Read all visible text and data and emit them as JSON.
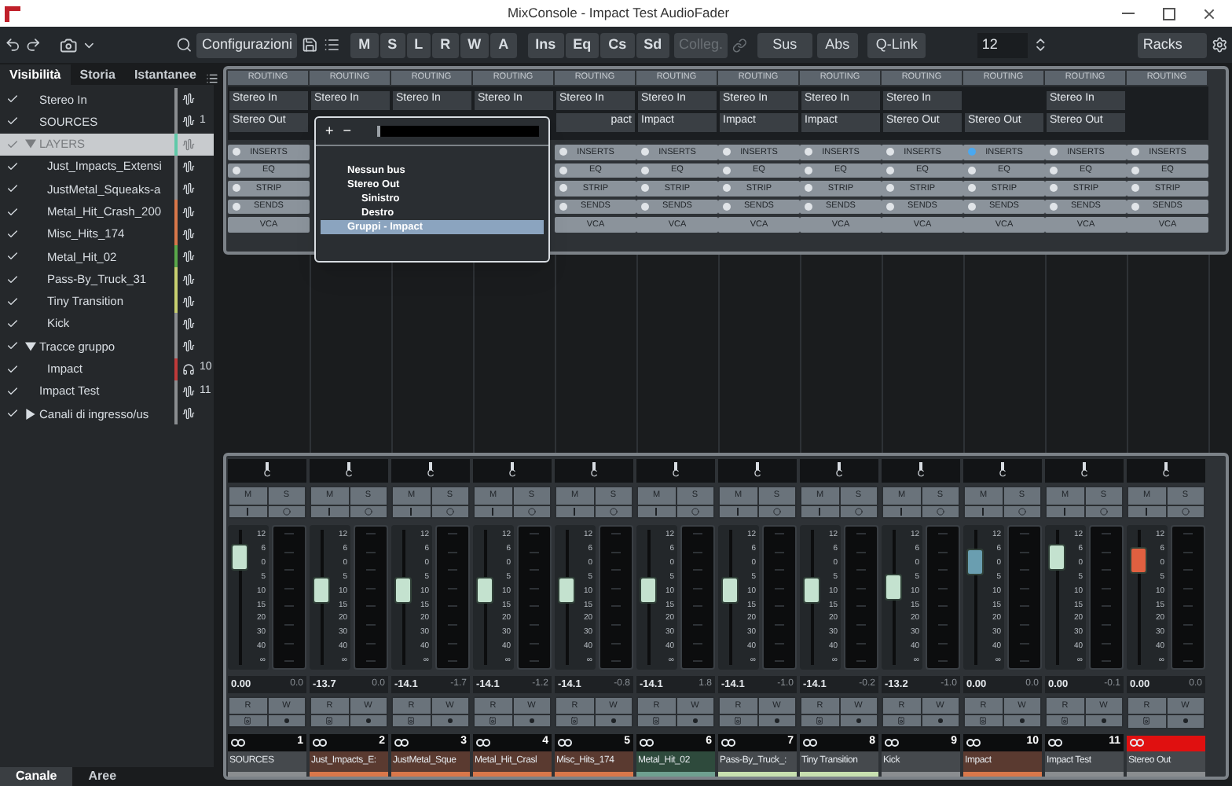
{
  "window": {
    "title": "MixConsole - Impact Test AudioFader"
  },
  "toolbar": {
    "config": "Configurazioni",
    "modes": [
      "M",
      "S",
      "L",
      "R",
      "W",
      "A"
    ],
    "views": [
      "Ins",
      "Eq",
      "Cs",
      "Sd"
    ],
    "link": "Colleg.",
    "sus": "Sus",
    "abs": "Abs",
    "qlink": "Q-Link",
    "count": "12",
    "racks": "Racks"
  },
  "left_tabs": [
    {
      "label": "Visibilità",
      "selected": true
    },
    {
      "label": "Storia",
      "selected": false
    },
    {
      "label": "Istantanee",
      "selected": false
    }
  ],
  "tree": [
    {
      "name": "Stereo In",
      "checked": true,
      "color": "#8a8d90"
    },
    {
      "name": "SOURCES",
      "checked": true,
      "color": "#8a8d90",
      "number": "1"
    },
    {
      "name": "LAYERS",
      "checked": true,
      "selected": true,
      "expanded": true,
      "color": "#5fc9a8",
      "children": [
        {
          "name": "Just_Impacts_Extensi",
          "checked": true,
          "color": "#8a8d90"
        },
        {
          "name": "JustMetal_Squeaks-a",
          "checked": true,
          "color": "#8a8d90"
        },
        {
          "name": "Metal_Hit_Crash_200",
          "checked": true,
          "color": "#d9774a"
        },
        {
          "name": "Misc_Hits_174",
          "checked": true,
          "color": "#d9774a"
        },
        {
          "name": "Metal_Hit_02",
          "checked": true,
          "color": "#5aa84a"
        },
        {
          "name": "Pass-By_Truck_31",
          "checked": true,
          "color": "#c8d070"
        },
        {
          "name": "Tiny Transition",
          "checked": true,
          "color": "#c8d070"
        },
        {
          "name": "Kick",
          "checked": true,
          "color": "#8a8d90"
        }
      ]
    },
    {
      "name": "Tracce gruppo",
      "checked": true,
      "expanded": true,
      "color": "#8a8d90",
      "children": [
        {
          "name": "Impact",
          "checked": true,
          "color": "#c03a3a",
          "number": "10",
          "kind": "group"
        }
      ]
    },
    {
      "name": "Impact Test",
      "checked": true,
      "color": "#8a8d90",
      "number": "11"
    },
    {
      "name": "Canali di ingresso/us",
      "checked": true,
      "expanded": false,
      "color": "#8a8d90"
    }
  ],
  "bottom_tabs": [
    {
      "label": "Canale",
      "selected": true
    },
    {
      "label": "Aree",
      "selected": false
    }
  ],
  "popup": {
    "plus": "+",
    "minus": "−",
    "items": [
      {
        "label": "Nessun bus",
        "selected": false
      },
      {
        "label": "Stereo Out",
        "selected": false,
        "children": [
          {
            "label": "Sinistro",
            "selected": false
          },
          {
            "label": "Destro",
            "selected": false
          }
        ]
      },
      {
        "label": "Gruppi - Impact",
        "selected": true
      }
    ]
  },
  "channels": [
    {
      "name": "SOURCES",
      "number": "1",
      "color": "#8a8d90",
      "kind": "audio",
      "routing": "ROUTING",
      "input": "Stereo In",
      "output": "Stereo Out",
      "sections": [
        "INSERTS",
        "EQ",
        "STRIP",
        "SENDS",
        "VCA"
      ],
      "inserts_on": false,
      "pan": {
        "label": "C",
        "level": 0.5
      },
      "mute": "M",
      "solo": "S",
      "level": 0.8,
      "scale": [
        "12",
        "6",
        "0",
        "5",
        "10",
        "15",
        "20",
        "30",
        "40",
        "∞"
      ],
      "volume": "0.00",
      "peak": "0.0",
      "read": "R",
      "write": "W"
    },
    {
      "name": "Just_Impacts_E:",
      "number": "2",
      "color": "#d9774a",
      "kind": "audio",
      "routing": "ROUTING",
      "input": "Stereo In",
      "pan": {
        "label": "C",
        "level": 0.5
      },
      "mute": "M",
      "solo": "S",
      "level": 0.55,
      "scale": [
        "12",
        "6",
        "0",
        "5",
        "10",
        "15",
        "20",
        "30",
        "40",
        "∞"
      ],
      "volume": "-13.7",
      "peak": "0.0",
      "read": "R",
      "write": "W"
    },
    {
      "name": "JustMetal_Sque",
      "number": "3",
      "color": "#d9774a",
      "kind": "audio",
      "routing": "ROUTING",
      "input": "Stereo In",
      "pan": {
        "label": "C",
        "level": 0.5
      },
      "mute": "M",
      "solo": "S",
      "level": 0.55,
      "scale": [
        "12",
        "6",
        "0",
        "5",
        "10",
        "15",
        "20",
        "30",
        "40",
        "∞"
      ],
      "volume": "-14.1",
      "peak": "-1.7",
      "read": "R",
      "write": "W"
    },
    {
      "name": "Metal_Hit_Crasl",
      "number": "4",
      "color": "#d9774a",
      "kind": "audio",
      "routing": "ROUTING",
      "input": "Stereo In",
      "pan": {
        "label": "C",
        "level": 0.5
      },
      "mute": "M",
      "solo": "S",
      "level": 0.55,
      "scale": [
        "12",
        "6",
        "0",
        "5",
        "10",
        "15",
        "20",
        "30",
        "40",
        "∞"
      ],
      "volume": "-14.1",
      "peak": "-1.2",
      "read": "R",
      "write": "W"
    },
    {
      "name": "Misc_Hits_174",
      "number": "5",
      "color": "#d9774a",
      "kind": "audio",
      "routing": "ROUTING",
      "input": "Stereo In",
      "output": "pact",
      "sections": [
        "INSERTS",
        "EQ",
        "STRIP",
        "SENDS",
        "VCA"
      ],
      "inserts_on": false,
      "pan": {
        "label": "C",
        "level": 0.5
      },
      "mute": "M",
      "solo": "S",
      "level": 0.55,
      "scale": [
        "12",
        "6",
        "0",
        "5",
        "10",
        "15",
        "20",
        "30",
        "40",
        "∞"
      ],
      "volume": "-14.1",
      "peak": "-0.8",
      "read": "R",
      "write": "W"
    },
    {
      "name": "Metal_Hit_02",
      "number": "6",
      "color": "#6fa090",
      "kind": "audio",
      "routing": "ROUTING",
      "input": "Stereo In",
      "output": "Impact",
      "sections": [
        "INSERTS",
        "EQ",
        "STRIP",
        "SENDS",
        "VCA"
      ],
      "inserts_on": false,
      "pan": {
        "label": "C",
        "level": 0.5
      },
      "mute": "M",
      "solo": "S",
      "level": 0.55,
      "scale": [
        "12",
        "6",
        "0",
        "5",
        "10",
        "15",
        "20",
        "30",
        "40",
        "∞"
      ],
      "volume": "-14.1",
      "peak": "1.8",
      "read": "R",
      "write": "W"
    },
    {
      "name": "Pass-By_Truck_:",
      "number": "7",
      "color": "#c8e0b0",
      "kind": "audio",
      "routing": "ROUTING",
      "input": "Stereo In",
      "output": "Impact",
      "sections": [
        "INSERTS",
        "EQ",
        "STRIP",
        "SENDS",
        "VCA"
      ],
      "inserts_on": false,
      "pan": {
        "label": "C",
        "level": 0.5
      },
      "mute": "M",
      "solo": "S",
      "level": 0.55,
      "scale": [
        "12",
        "6",
        "0",
        "5",
        "10",
        "15",
        "20",
        "30",
        "40",
        "∞"
      ],
      "volume": "-14.1",
      "peak": "-1.0",
      "read": "R",
      "write": "W"
    },
    {
      "name": "Tiny Transition",
      "number": "8",
      "color": "#c8e0b0",
      "kind": "audio",
      "routing": "ROUTING",
      "input": "Stereo In",
      "output": "Impact",
      "sections": [
        "INSERTS",
        "EQ",
        "STRIP",
        "SENDS",
        "VCA"
      ],
      "inserts_on": false,
      "pan": {
        "label": "C",
        "level": 0.5
      },
      "mute": "M",
      "solo": "S",
      "level": 0.55,
      "scale": [
        "12",
        "6",
        "0",
        "5",
        "10",
        "15",
        "20",
        "30",
        "40",
        "∞"
      ],
      "volume": "-14.1",
      "peak": "-0.2",
      "read": "R",
      "write": "W"
    },
    {
      "name": "Kick",
      "number": "9",
      "color": "#8a8d90",
      "kind": "audio",
      "routing": "ROUTING",
      "input": "Stereo In",
      "output": "Stereo Out",
      "sections": [
        "INSERTS",
        "EQ",
        "STRIP",
        "SENDS",
        "VCA"
      ],
      "inserts_on": false,
      "pan": {
        "label": "C",
        "level": 0.5
      },
      "mute": "M",
      "solo": "S",
      "level": 0.58,
      "scale": [
        "12",
        "6",
        "0",
        "5",
        "10",
        "15",
        "20",
        "30",
        "40",
        "∞"
      ],
      "volume": "-13.2",
      "peak": "-1.0",
      "read": "R",
      "write": "W"
    },
    {
      "name": "Impact",
      "number": "10",
      "color": "#d9774a",
      "kind": "group",
      "routing": "ROUTING",
      "output": "Stereo Out",
      "sections": [
        "INSERTS",
        "EQ",
        "STRIP",
        "SENDS",
        "VCA"
      ],
      "inserts_on": true,
      "pan": {
        "label": "C",
        "level": 0.5
      },
      "mute": "M",
      "solo": "S",
      "level": 0.76,
      "scale": [
        "12",
        "6",
        "0",
        "5",
        "10",
        "15",
        "20",
        "30",
        "40",
        "∞"
      ],
      "volume": "0.00",
      "peak": "0.0",
      "read": "R",
      "write": "W"
    },
    {
      "name": "Impact Test",
      "number": "11",
      "color": "#8a8d90",
      "kind": "audio",
      "routing": "ROUTING",
      "input": "Stereo In",
      "output": "Stereo Out",
      "sections": [
        "INSERTS",
        "EQ",
        "STRIP",
        "SENDS",
        "VCA"
      ],
      "inserts_on": false,
      "pan": {
        "label": "C",
        "level": 0.5
      },
      "mute": "M",
      "solo": "S",
      "level": 0.8,
      "scale": [
        "12",
        "6",
        "0",
        "5",
        "10",
        "15",
        "20",
        "30",
        "40",
        "∞"
      ],
      "volume": "0.00",
      "peak": "-0.1",
      "read": "R",
      "write": "W"
    },
    {
      "name": "Stereo Out",
      "color": "#8a8d90",
      "kind": "output",
      "routing": "ROUTING",
      "sections": [
        "INSERTS",
        "EQ",
        "STRIP",
        "SENDS",
        "VCA"
      ],
      "inserts_on": false,
      "pan": {
        "label": "C",
        "level": 0.5
      },
      "mute": "M",
      "solo": "S",
      "level": 0.77,
      "scale": [
        "12",
        "6",
        "0",
        "5",
        "10",
        "15",
        "20",
        "30",
        "40",
        "∞"
      ],
      "volume": "0.00",
      "peak": "0.0",
      "read": "R",
      "write": "W"
    }
  ]
}
